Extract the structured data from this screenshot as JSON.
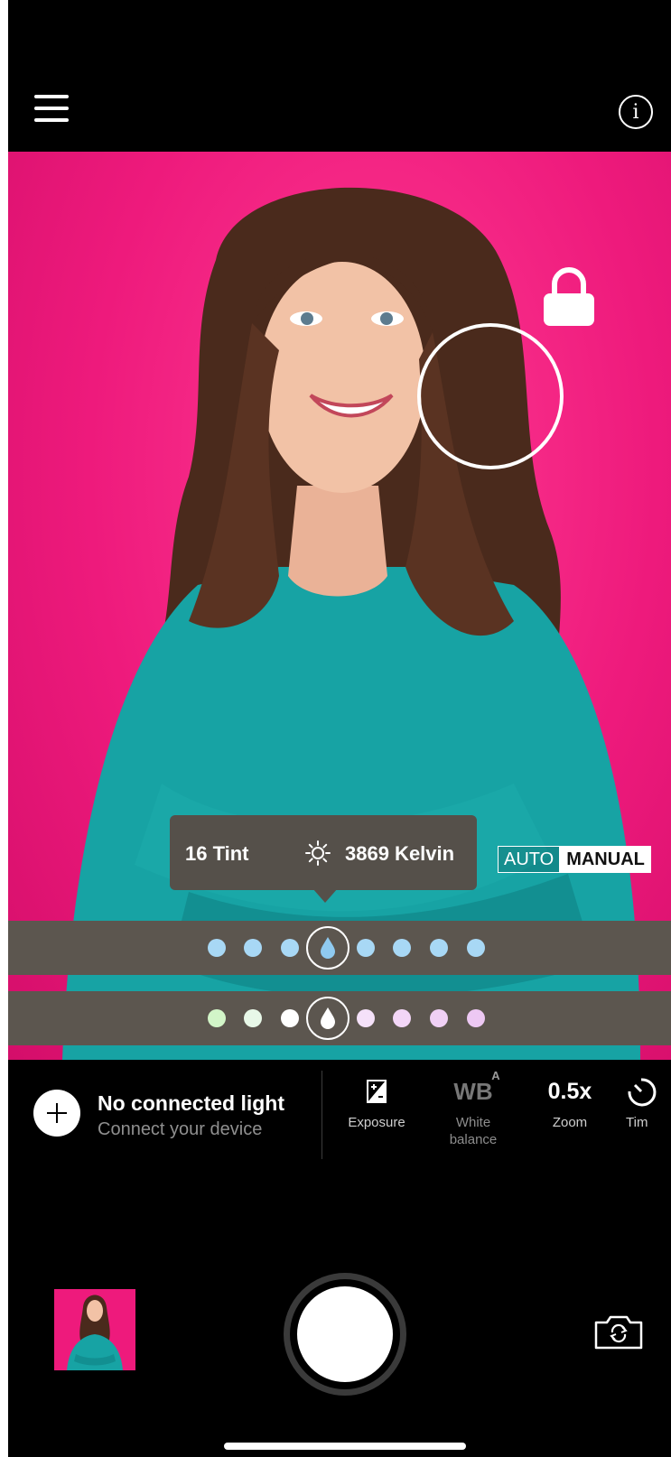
{
  "top_bar": {
    "menu_icon": "hamburger-menu-icon",
    "info_icon": "info-icon",
    "info_glyph": "i"
  },
  "viewfinder": {
    "background_color": "#ee1a7c",
    "lock_icon": "lock-icon",
    "focus_ring": "focus-ring"
  },
  "white_balance": {
    "tint_label": "16 Tint",
    "kelvin_label": "3869 Kelvin",
    "sun_icon": "sun-icon",
    "mode_auto": "AUTO",
    "mode_manual": "MANUAL",
    "selected_mode": "MANUAL"
  },
  "tint_slider": {
    "dot_color": "#a8d8f5",
    "knob_icon": "blue-drop-icon"
  },
  "temperature_slider": {
    "dot_colors": [
      "#d2f5c8",
      "#e8f8e8",
      "#ffffff",
      "#f5e1f9",
      "#f3d6f7",
      "#f0d0f5",
      "#edc8f3"
    ],
    "knob_icon": "white-drop-icon"
  },
  "light": {
    "title": "No connected light",
    "subtitle": "Connect your device",
    "add_icon": "plus-icon"
  },
  "tools": {
    "exposure": {
      "label": "Exposure",
      "icon": "exposure-icon"
    },
    "white_balance": {
      "glyph": "WB",
      "sup": "A",
      "label_line1": "White",
      "label_line2": "balance"
    },
    "zoom": {
      "value": "0.5x",
      "label": "Zoom"
    },
    "timer": {
      "label": "Tim",
      "icon": "timer-icon"
    }
  },
  "bottom": {
    "thumbnail": "last-photo-thumbnail",
    "shutter": "shutter-button",
    "flip_icon": "flip-camera-icon"
  }
}
